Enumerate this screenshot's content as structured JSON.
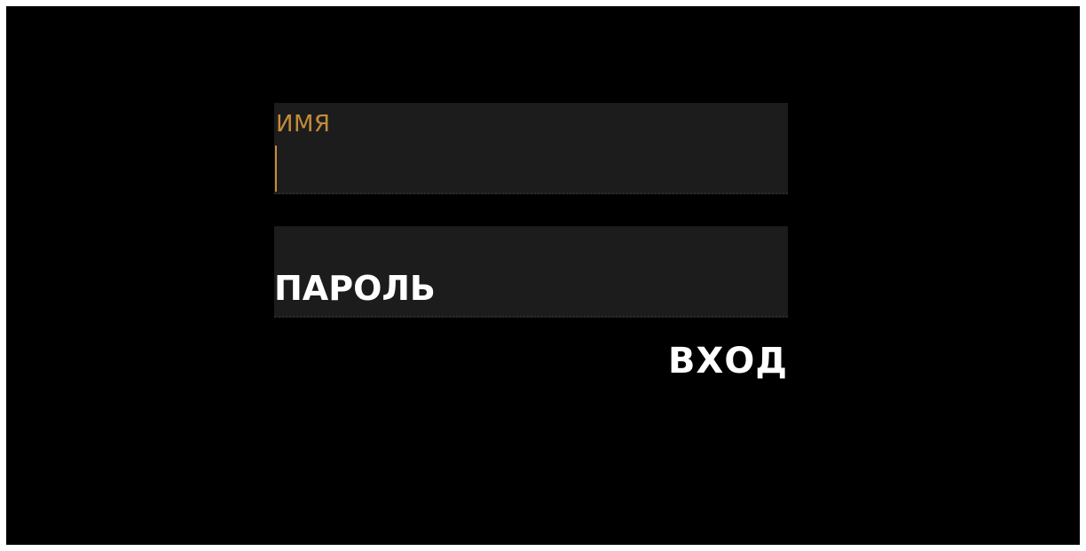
{
  "login_form": {
    "name_field": {
      "label": "ИМЯ",
      "value": ""
    },
    "password_field": {
      "label": "ПАРОЛЬ",
      "value": ""
    },
    "submit_label": "ВХОД"
  },
  "colors": {
    "background": "#000000",
    "field_background": "#1c1c1c",
    "accent": "#c38c3a",
    "text": "#ffffff"
  }
}
